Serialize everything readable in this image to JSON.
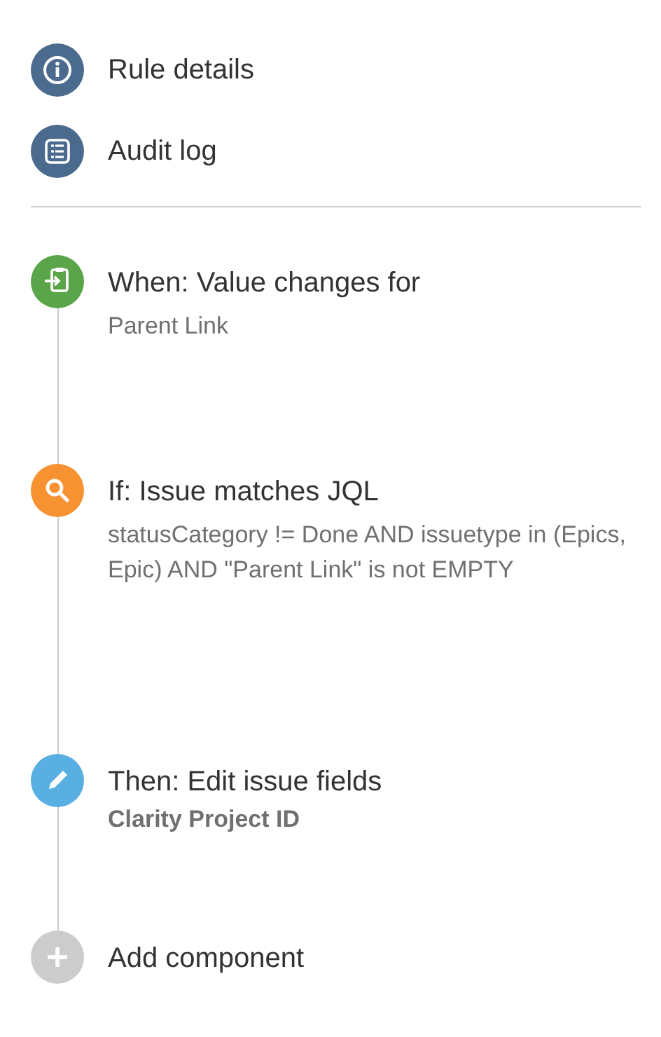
{
  "nav_items": [
    {
      "kind": "info",
      "label": "Rule details"
    },
    {
      "kind": "log",
      "label": "Audit log"
    }
  ],
  "steps": [
    {
      "kind": "trigger",
      "title": "When: Value changes for",
      "detail": "Parent Link",
      "bold": false
    },
    {
      "kind": "condition",
      "title": "If: Issue matches JQL",
      "detail": "statusCategory != Done AND issuetype in (Epics, Epic) AND \"Parent Link\" is not EMPTY",
      "bold": false
    },
    {
      "kind": "action",
      "title": "Then: Edit issue fields",
      "detail": "Clarity Project ID",
      "bold": true
    },
    {
      "kind": "add",
      "title": "Add component"
    }
  ]
}
